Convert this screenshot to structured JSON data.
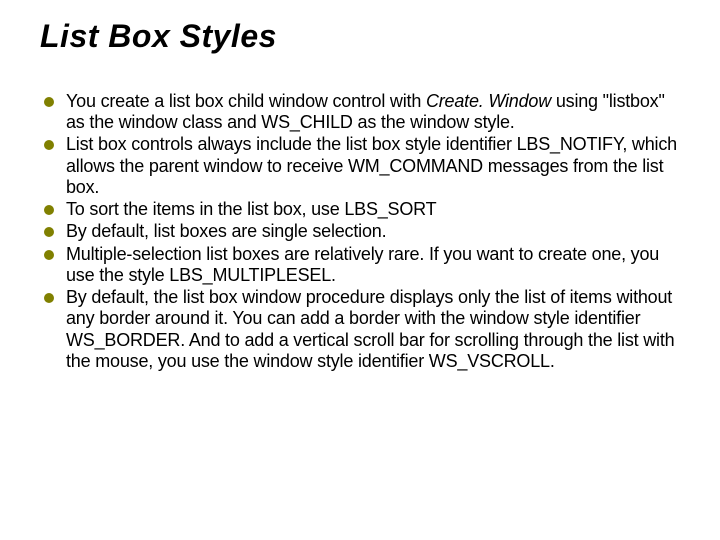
{
  "title": "List Box Styles",
  "bullets": [
    {
      "parts": [
        {
          "text": "You create a list box child window control with ",
          "italic": false
        },
        {
          "text": "Create. Window",
          "italic": true
        },
        {
          "text": " using \"listbox\" as the window class and WS_CHILD as the window style.",
          "italic": false
        }
      ]
    },
    {
      "parts": [
        {
          "text": "List box controls always include the list box style identifier LBS_NOTIFY, which allows the parent window to receive WM_COMMAND messages from the list box.",
          "italic": false
        }
      ]
    },
    {
      "parts": [
        {
          "text": "To sort the items in the list box, use LBS_SORT",
          "italic": false
        }
      ]
    },
    {
      "parts": [
        {
          "text": "By default, list boxes are single selection.",
          "italic": false
        }
      ]
    },
    {
      "parts": [
        {
          "text": "Multiple-selection list boxes are relatively rare. If you want to create one, you use the style LBS_MULTIPLESEL.",
          "italic": false
        }
      ]
    },
    {
      "parts": [
        {
          "text": "By default, the list box window procedure displays only the list of items without any border around it. You can add a border with the window style identifier WS_BORDER. And to add a vertical scroll bar for scrolling through the list with the mouse, you use the window style identifier WS_VSCROLL.",
          "italic": false
        }
      ]
    }
  ]
}
